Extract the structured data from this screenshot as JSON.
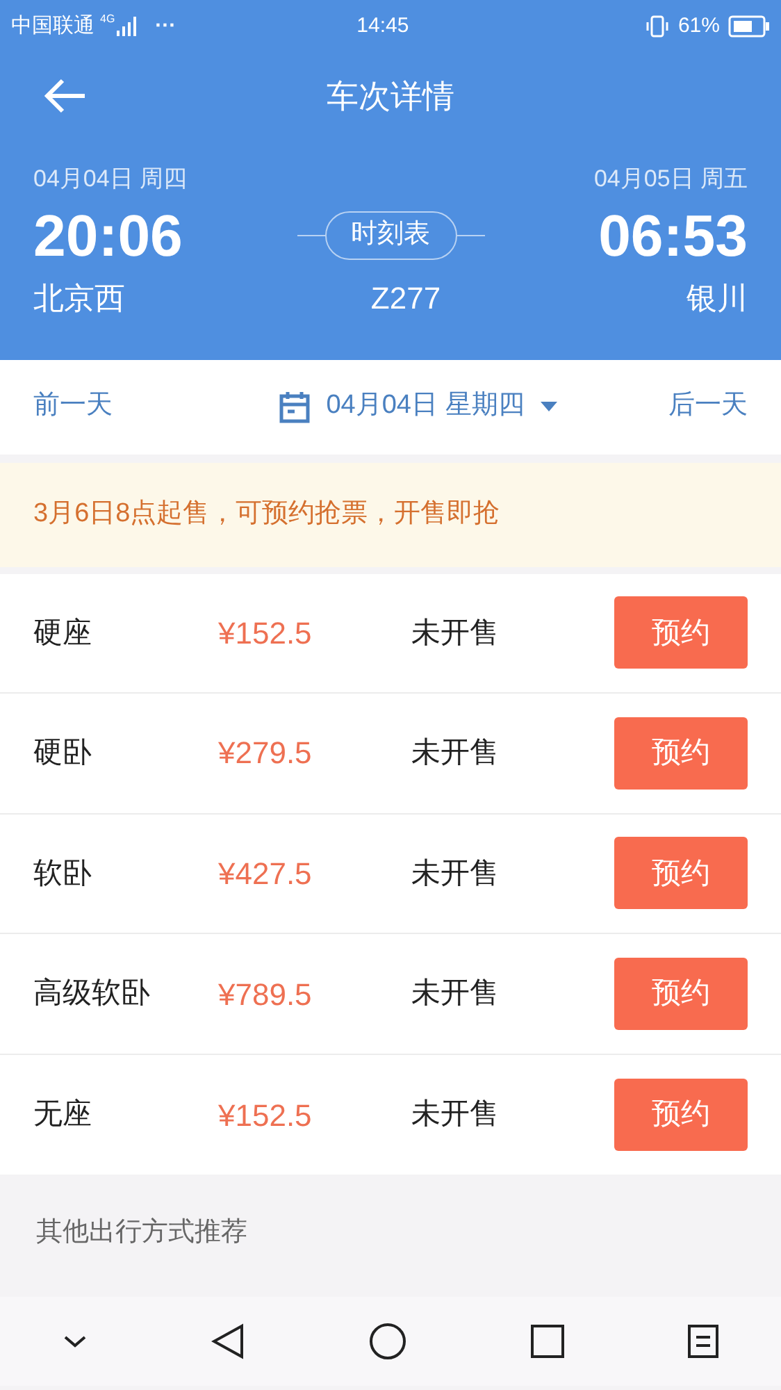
{
  "status_bar": {
    "carrier": "中国联通",
    "network": "4G",
    "more": "···",
    "time": "14:45",
    "battery": "61%"
  },
  "header": {
    "title": "车次详情"
  },
  "trip": {
    "depart_date": "04月04日 周四",
    "arrive_date": "04月05日 周五",
    "depart_time": "20:06",
    "arrive_time": "06:53",
    "timetable": "时刻表",
    "from": "北京西",
    "train": "Z277",
    "to": "银川"
  },
  "date_bar": {
    "prev": "前一天",
    "date": "04月04日 星期四",
    "next": "后一天"
  },
  "notice": "3月6日8点起售，可预约抢票，开售即抢",
  "seats": [
    {
      "name": "硬座",
      "price": "¥152.5",
      "status": "未开售",
      "action": "预约"
    },
    {
      "name": "硬卧",
      "price": "¥279.5",
      "status": "未开售",
      "action": "预约"
    },
    {
      "name": "软卧",
      "price": "¥427.5",
      "status": "未开售",
      "action": "预约"
    },
    {
      "name": "高级软卧",
      "price": "¥789.5",
      "status": "未开售",
      "action": "预约"
    },
    {
      "name": "无座",
      "price": "¥152.5",
      "status": "未开售",
      "action": "预约"
    }
  ],
  "recommend": "其他出行方式推荐"
}
